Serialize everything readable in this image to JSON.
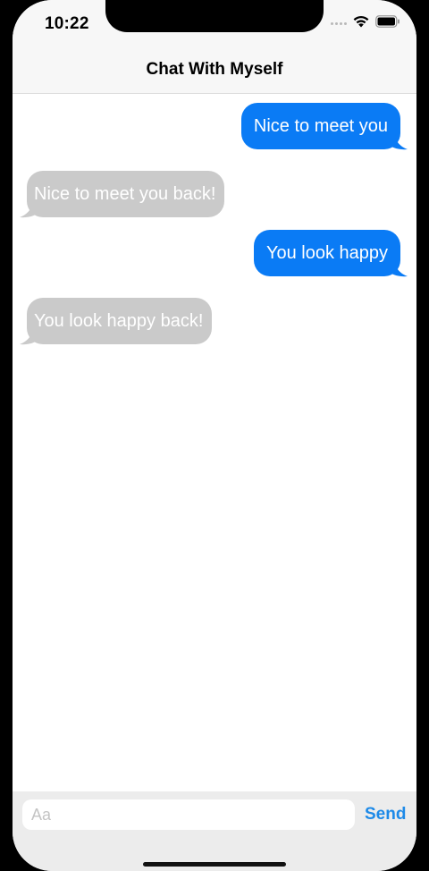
{
  "status_bar": {
    "time": "10:22",
    "icons": [
      "signal-icon",
      "wifi-icon",
      "battery-icon"
    ]
  },
  "nav": {
    "title": "Chat With Myself"
  },
  "messages": [
    {
      "text": "Nice to meet you",
      "direction": "sent"
    },
    {
      "text": "Nice to meet you back!",
      "direction": "received"
    },
    {
      "text": "You look happy",
      "direction": "sent"
    },
    {
      "text": "You look happy back!",
      "direction": "received"
    }
  ],
  "composer": {
    "placeholder": "Aa",
    "value": "",
    "send_label": "Send"
  },
  "colors": {
    "sent_bubble": "#0a7bf5",
    "received_bubble": "#cacaca",
    "send_button": "#1e8ae8"
  }
}
